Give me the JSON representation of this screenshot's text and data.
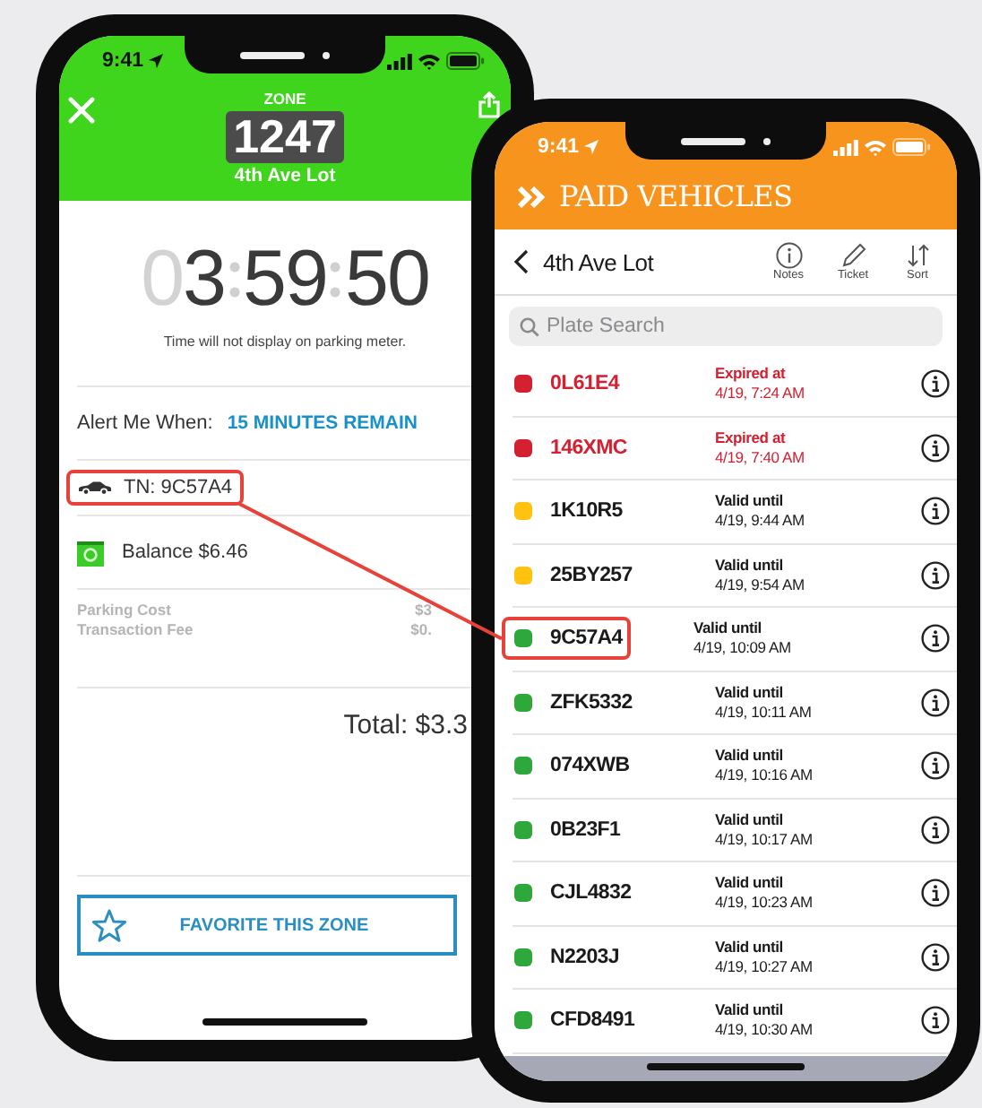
{
  "zone_screen": {
    "status_time": "9:41",
    "zone_label": "ZONE",
    "zone_number": "1247",
    "lot_name": "4th Ave Lot",
    "timer": {
      "dim": "0",
      "parts": [
        "3",
        "59",
        "50"
      ]
    },
    "meter_note": "Time will not display on parking meter.",
    "alert": {
      "label": "Alert Me When:",
      "value": "15 MINUTES REMAIN"
    },
    "vehicle": {
      "text": "TN: 9C57A4",
      "highlighted": true
    },
    "balance": "Balance $6.46",
    "charges": [
      {
        "label": "Parking Cost",
        "amount": "$3"
      },
      {
        "label": "Transaction Fee",
        "amount": "$0."
      }
    ],
    "total": "Total: $3.3",
    "favorite_button": "FAVORITE THIS ZONE"
  },
  "vehicles_screen": {
    "status_time": "9:41",
    "title": "PAID VEHICLES",
    "lot_name": "4th Ave Lot",
    "actions": [
      {
        "label": "Notes",
        "kind": "info"
      },
      {
        "label": "Ticket",
        "kind": "pencil"
      },
      {
        "label": "Sort",
        "kind": "sort"
      }
    ],
    "search": {
      "placeholder": "Plate Search"
    },
    "rows": [
      {
        "plate": "0L61E4",
        "expired": true,
        "color": "#d42030",
        "status_label": "Expired at",
        "time": "4/19, 7:24 AM",
        "highlighted": false
      },
      {
        "plate": "146XMC",
        "expired": true,
        "color": "#d42030",
        "status_label": "Expired at",
        "time": "4/19, 7:40 AM",
        "highlighted": false
      },
      {
        "plate": "1K10R5",
        "expired": false,
        "color": "#ffc20e",
        "status_label": "Valid until",
        "time": "4/19, 9:44 AM",
        "highlighted": false
      },
      {
        "plate": "25BY257",
        "expired": false,
        "color": "#ffc20e",
        "status_label": "Valid until",
        "time": "4/19, 9:54 AM",
        "highlighted": false
      },
      {
        "plate": "9C57A4",
        "expired": false,
        "color": "#2ea83a",
        "status_label": "Valid until",
        "time": "4/19, 10:09 AM",
        "highlighted": true
      },
      {
        "plate": "ZFK5332",
        "expired": false,
        "color": "#2ea83a",
        "status_label": "Valid until",
        "time": "4/19, 10:11 AM",
        "highlighted": false
      },
      {
        "plate": "074XWB",
        "expired": false,
        "color": "#2ea83a",
        "status_label": "Valid until",
        "time": "4/19, 10:16 AM",
        "highlighted": false
      },
      {
        "plate": "0B23F1",
        "expired": false,
        "color": "#2ea83a",
        "status_label": "Valid until",
        "time": "4/19, 10:17 AM",
        "highlighted": false
      },
      {
        "plate": "CJL4832",
        "expired": false,
        "color": "#2ea83a",
        "status_label": "Valid until",
        "time": "4/19, 10:23 AM",
        "highlighted": false
      },
      {
        "plate": "N2203J",
        "expired": false,
        "color": "#2ea83a",
        "status_label": "Valid until",
        "time": "4/19, 10:27 AM",
        "highlighted": false
      },
      {
        "plate": "CFD8491",
        "expired": false,
        "color": "#2ea83a",
        "status_label": "Valid until",
        "time": "4/19, 10:30 AM",
        "highlighted": false
      }
    ]
  }
}
